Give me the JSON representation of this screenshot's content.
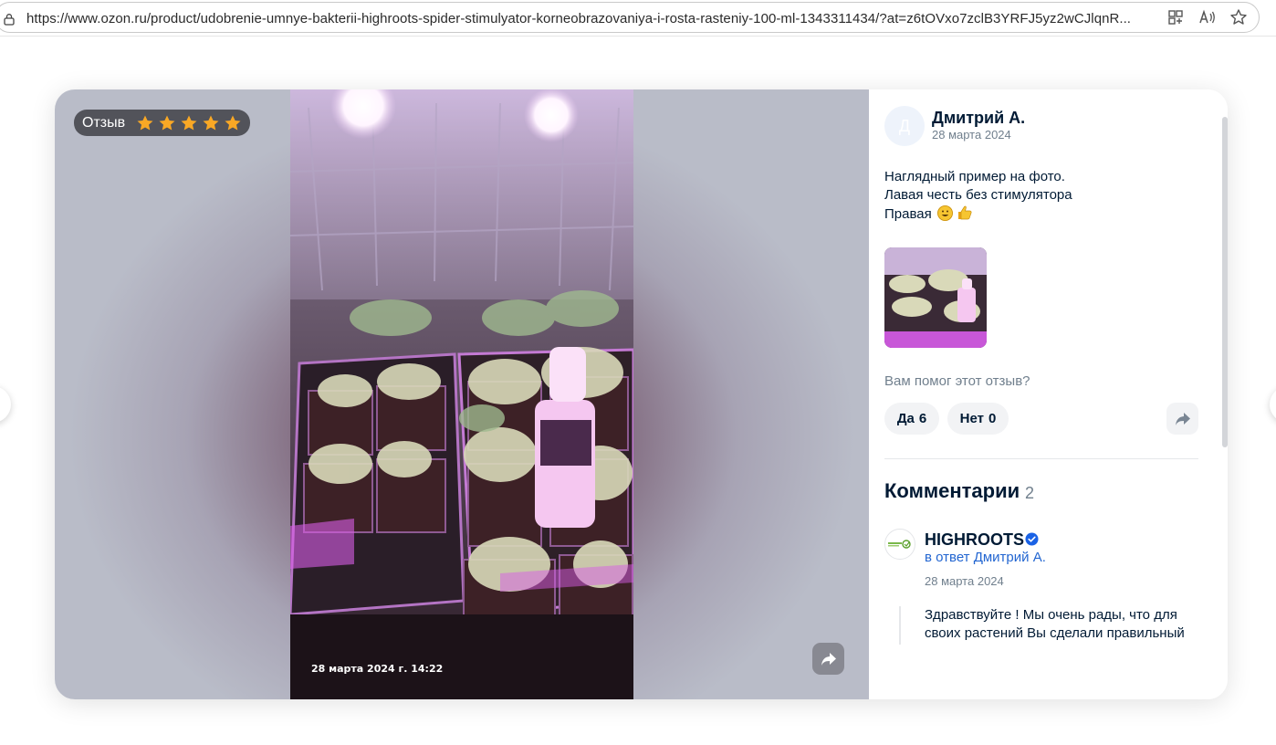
{
  "browser": {
    "url": "https://www.ozon.ru/product/udobrenie-umnye-bakterii-highroots-spider-stimulyator-korneobrazovaniya-i-rosta-rasteniy-100-ml-1343311434/?at=z6tOVxo7zclB3YRFJ5yz2wCJlqnR...",
    "icons": [
      "lock-icon",
      "app-available-icon",
      "read-aloud-icon",
      "favorite-star-icon"
    ]
  },
  "media": {
    "badge_label": "Отзыв",
    "rating": 5,
    "rating_max": 5,
    "star_color": "#f9a825",
    "photo_date": "28 марта 2024 г. 14:22"
  },
  "review": {
    "avatar_letter": "Д",
    "author": "Дмитрий А.",
    "date": "28 марта 2024",
    "text_lines": [
      "Наглядный пример на фото.",
      "Лавая честь без стимулятора",
      "Правая"
    ],
    "emojis": [
      "smiley-emoji",
      "thumbs-up-emoji"
    ],
    "helpful_question": "Вам помог этот отзыв?",
    "yes_label": "Да",
    "yes_count": "6",
    "no_label": "Нет",
    "no_count": "0"
  },
  "comments": {
    "title": "Комментарии",
    "count": "2",
    "items": [
      {
        "author": "HIGHROOTS",
        "verified": true,
        "reply_to": "в ответ Дмитрий А.",
        "date": "28 марта 2024",
        "text": "Здравствуйте ! Мы очень рады, что для своих растений Вы сделали правильный"
      }
    ]
  },
  "colors": {
    "accent": "#2366d1",
    "text": "#001a34",
    "muted": "#707f8d"
  }
}
